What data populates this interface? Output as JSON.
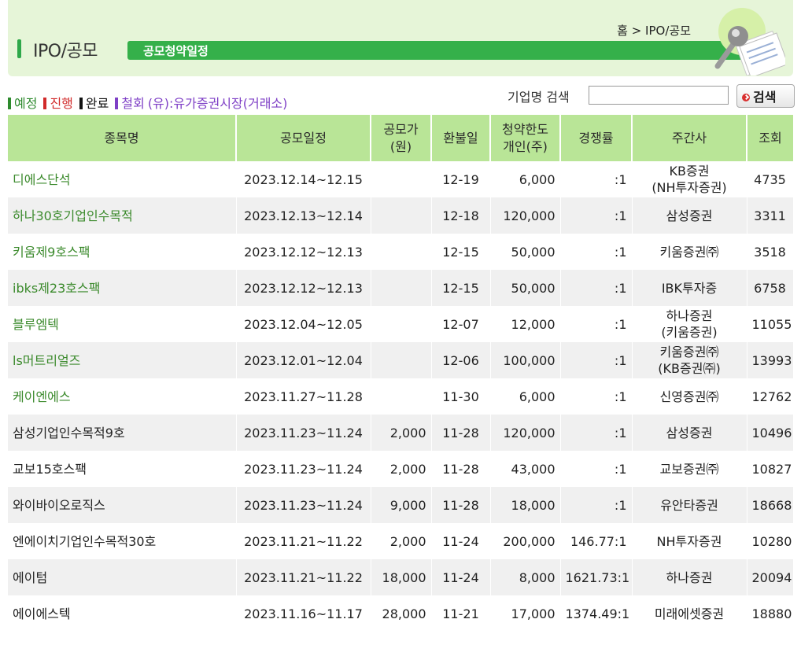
{
  "header": {
    "title": "IPO/공모",
    "subtitle": "공모청약일정",
    "breadcrumb": "홈 > IPO/공모"
  },
  "legend": {
    "items": [
      {
        "label": "예정",
        "color": "#2d8a2d"
      },
      {
        "label": "진행",
        "color": "#d12a2a"
      },
      {
        "label": "완료",
        "color": "#111111"
      },
      {
        "label": "철회",
        "color": "#7e3fc6"
      }
    ],
    "note": "(유):유가증권시장(거래소)"
  },
  "search": {
    "label": "기업명 검색",
    "value": "",
    "button_label": "검색"
  },
  "table": {
    "headers": [
      "종목명",
      "공모일정",
      "공모가\n(원)",
      "환불일",
      "청약한도\n개인(주)",
      "경쟁률",
      "주간사",
      "조회"
    ],
    "rows": [
      {
        "name": "디에스단석",
        "status": "green",
        "schedule": "2023.12.14~12.15",
        "price": "",
        "refund": "12-19",
        "limit": "6,000",
        "ratio": ":1",
        "underwriter": "KB증권\n(NH투자증권)",
        "views": "4735"
      },
      {
        "name": "하나30호기업인수목적",
        "status": "green",
        "schedule": "2023.12.13~12.14",
        "price": "",
        "refund": "12-18",
        "limit": "120,000",
        "ratio": ":1",
        "underwriter": "삼성증권",
        "views": "3311"
      },
      {
        "name": "키움제9호스팩",
        "status": "green",
        "schedule": "2023.12.12~12.13",
        "price": "",
        "refund": "12-15",
        "limit": "50,000",
        "ratio": ":1",
        "underwriter": "키움증권㈜",
        "views": "3518"
      },
      {
        "name": "ibks제23호스팩",
        "status": "green",
        "schedule": "2023.12.12~12.13",
        "price": "",
        "refund": "12-15",
        "limit": "50,000",
        "ratio": ":1",
        "underwriter": "IBK투자증",
        "views": "6758"
      },
      {
        "name": "블루엠텍",
        "status": "green",
        "schedule": "2023.12.04~12.05",
        "price": "",
        "refund": "12-07",
        "limit": "12,000",
        "ratio": ":1",
        "underwriter": "하나증권\n(키움증권)",
        "views": "11055"
      },
      {
        "name": "ls머트리얼즈",
        "status": "green",
        "schedule": "2023.12.01~12.04",
        "price": "",
        "refund": "12-06",
        "limit": "100,000",
        "ratio": ":1",
        "underwriter": "키움증권㈜\n(KB증권㈜)",
        "views": "13993"
      },
      {
        "name": "케이엔에스",
        "status": "green",
        "schedule": "2023.11.27~11.28",
        "price": "",
        "refund": "11-30",
        "limit": "6,000",
        "ratio": ":1",
        "underwriter": "신영증권㈜",
        "views": "12762"
      },
      {
        "name": "삼성기업인수목적9호",
        "status": "black",
        "schedule": "2023.11.23~11.24",
        "price": "2,000",
        "refund": "11-28",
        "limit": "120,000",
        "ratio": ":1",
        "underwriter": "삼성증권",
        "views": "10496"
      },
      {
        "name": "교보15호스팩",
        "status": "black",
        "schedule": "2023.11.23~11.24",
        "price": "2,000",
        "refund": "11-28",
        "limit": "43,000",
        "ratio": ":1",
        "underwriter": "교보증권㈜",
        "views": "10827"
      },
      {
        "name": "와이바이오로직스",
        "status": "black",
        "schedule": "2023.11.23~11.24",
        "price": "9,000",
        "refund": "11-28",
        "limit": "18,000",
        "ratio": ":1",
        "underwriter": "유안타증권",
        "views": "18668"
      },
      {
        "name": "엔에이치기업인수목적30호",
        "status": "black",
        "schedule": "2023.11.21~11.22",
        "price": "2,000",
        "refund": "11-24",
        "limit": "200,000",
        "ratio": "146.77:1",
        "underwriter": "NH투자증권",
        "views": "10280"
      },
      {
        "name": "에이텀",
        "status": "black",
        "schedule": "2023.11.21~11.22",
        "price": "18,000",
        "refund": "11-24",
        "limit": "8,000",
        "ratio": "1621.73:1",
        "underwriter": "하나증권",
        "views": "20094"
      },
      {
        "name": "에이에스텍",
        "status": "black",
        "schedule": "2023.11.16~11.17",
        "price": "28,000",
        "refund": "11-21",
        "limit": "17,000",
        "ratio": "1374.49:1",
        "underwriter": "미래에셋증권",
        "views": "18880"
      }
    ]
  }
}
